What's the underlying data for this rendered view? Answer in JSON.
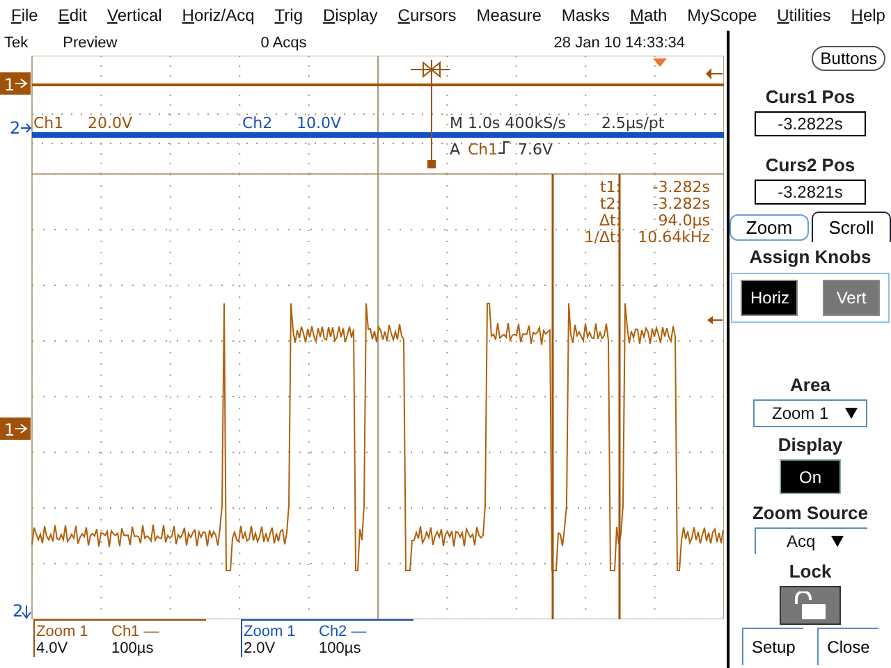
{
  "menu": [
    {
      "mnemonic": "F",
      "rest": "ile"
    },
    {
      "mnemonic": "E",
      "rest": "dit"
    },
    {
      "mnemonic": "V",
      "rest": "ertical"
    },
    {
      "mnemonic": "H",
      "rest": "oriz/Acq"
    },
    {
      "mnemonic": "T",
      "rest": "rig"
    },
    {
      "mnemonic": "D",
      "rest": "isplay"
    },
    {
      "mnemonic": "C",
      "rest": "ursors"
    },
    {
      "rest": "Measure"
    },
    {
      "rest": "Masks"
    },
    {
      "mnemonic": "M",
      "rest": "ath"
    },
    {
      "rest": "MyScope"
    },
    {
      "mnemonic": "U",
      "rest": "tilities"
    },
    {
      "mnemonic": "H",
      "rest": "elp"
    }
  ],
  "status_bar": {
    "brand": "Tek",
    "mode": "Preview",
    "acquisitions": "0 Acqs",
    "datetime": "28 Jan 10 14:33:34"
  },
  "overview": {
    "channel_markers": [
      {
        "label": "1",
        "color": "#a0520a"
      },
      {
        "label": "2",
        "color": "#1450c0"
      }
    ],
    "channels": [
      {
        "name": "Ch1",
        "scale": "20.0V",
        "color": "#a0520a"
      },
      {
        "name": "Ch2",
        "scale": "10.0V",
        "color": "#1450c0"
      }
    ],
    "timebase": "M 1.0s 400kS/s",
    "resolution": "2.5µs/pt",
    "trigger": {
      "label": "A",
      "source": "Ch1",
      "level": "7.6V"
    }
  },
  "main_display": {
    "channel_markers": [
      {
        "label": "1",
        "color": "#a0520a"
      },
      {
        "label": "2",
        "color": "#1450c0"
      }
    ],
    "cursor_readouts": [
      {
        "label": "t1:",
        "value": "-3.282s"
      },
      {
        "label": "t2:",
        "value": "-3.282s"
      },
      {
        "label": "Δt:",
        "value": "94.0µs"
      },
      {
        "label": "1/Δt:",
        "value": "10.64kHz"
      }
    ]
  },
  "zoom_readouts": [
    {
      "zoom": "Zoom 1",
      "channel": "Ch1",
      "line": "—",
      "volts": "4.0V",
      "time": "100µs",
      "color": "#a0520a"
    },
    {
      "zoom": "Zoom 1",
      "channel": "Ch2",
      "line": "—",
      "volts": "2.0V",
      "time": "100µs",
      "color": "#1450c0"
    }
  ],
  "side_panel": {
    "buttons_label": "Buttons",
    "cursors": [
      {
        "label": "Curs1 Pos",
        "value": "-3.2822s"
      },
      {
        "label": "Curs2 Pos",
        "value": "-3.2821s"
      }
    ],
    "tabs": [
      {
        "label": "Zoom",
        "selected": false
      },
      {
        "label": "Scroll",
        "selected": true
      }
    ],
    "assign_knobs": {
      "title": "Assign Knobs",
      "options": [
        {
          "label": "Horiz",
          "selected": true
        },
        {
          "label": "Vert",
          "selected": false
        }
      ]
    },
    "area": {
      "title": "Area",
      "value": "Zoom 1"
    },
    "display": {
      "title": "Display",
      "value": "On"
    },
    "zoom_source": {
      "title": "Zoom Source",
      "value": "Acq"
    },
    "lock": {
      "title": "Lock",
      "locked": false
    },
    "footer_buttons": [
      "Setup",
      "Close"
    ]
  }
}
